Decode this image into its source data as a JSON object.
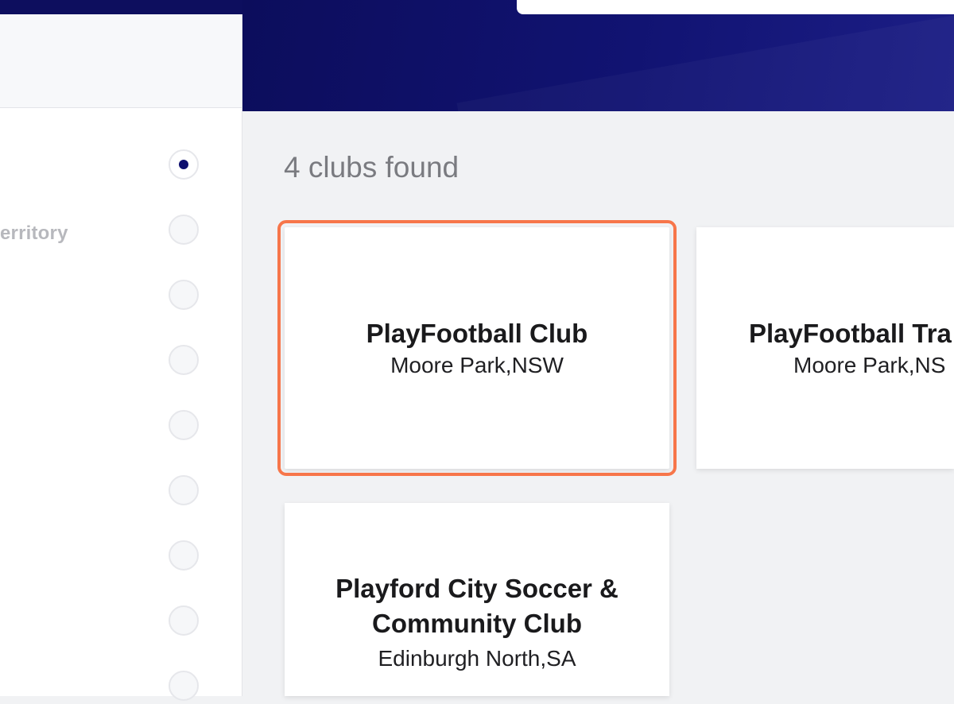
{
  "sidebar": {
    "filters": [
      {
        "label": "",
        "checked": true
      },
      {
        "label": "erritory",
        "checked": false
      },
      {
        "label": "",
        "checked": false
      },
      {
        "label": "",
        "checked": false
      },
      {
        "label": "",
        "checked": false
      },
      {
        "label": "",
        "checked": false
      },
      {
        "label": "",
        "checked": false
      },
      {
        "label": "",
        "checked": false
      },
      {
        "label": "",
        "checked": false
      }
    ]
  },
  "results": {
    "count_text": "4 clubs found",
    "clubs": [
      {
        "name": "PlayFootball Club",
        "location": "Moore Park,NSW"
      },
      {
        "name": "PlayFootball Tra",
        "location": "Moore Park,NS"
      },
      {
        "name_line1": "Playford City Soccer &",
        "name_line2": "Community Club",
        "location": "Edinburgh North,SA"
      }
    ]
  },
  "colors": {
    "header": "#0c0d5c",
    "selected_outline": "#f7764a",
    "radio_dot": "#0d0e6e"
  }
}
